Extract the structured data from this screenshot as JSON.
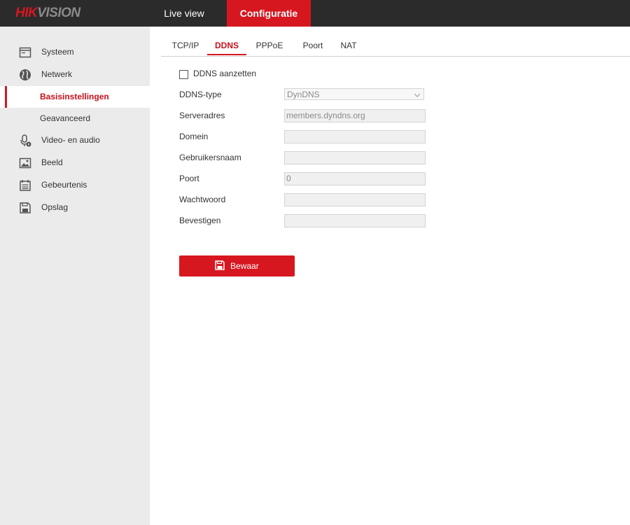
{
  "brand": {
    "logo_hik": "HIK",
    "logo_vision": "VISION"
  },
  "topnav": {
    "live_view": "Live view",
    "configuratie": "Configuratie"
  },
  "sidebar": {
    "items": [
      {
        "label": "Systeem",
        "icon": "system-icon"
      },
      {
        "label": "Netwerk",
        "icon": "globe-icon"
      },
      {
        "label": "Basisinstellingen",
        "active": true
      },
      {
        "label": "Geavanceerd"
      },
      {
        "label": "Video- en audio",
        "icon": "microphone-icon"
      },
      {
        "label": "Beeld",
        "icon": "image-icon"
      },
      {
        "label": "Gebeurtenis",
        "icon": "calendar-icon"
      },
      {
        "label": "Opslag",
        "icon": "storage-icon"
      }
    ]
  },
  "tabs": [
    {
      "label": "TCP/IP"
    },
    {
      "label": "DDNS",
      "active": true
    },
    {
      "label": "PPPoE"
    },
    {
      "label": "Poort"
    },
    {
      "label": "NAT"
    }
  ],
  "form": {
    "enable_label": "DDNS aanzetten",
    "enable_checked": false,
    "ddns_type_label": "DDNS-type",
    "ddns_type_value": "DynDNS",
    "server_label": "Serveradres",
    "server_value": "members.dyndns.org",
    "domain_label": "Domein",
    "domain_value": "",
    "username_label": "Gebruikersnaam",
    "username_value": "",
    "port_label": "Poort",
    "port_value": "0",
    "password_label": "Wachtwoord",
    "password_value": "",
    "confirm_label": "Bevestigen",
    "confirm_value": ""
  },
  "actions": {
    "save_label": "Bewaar"
  },
  "colors": {
    "accent": "#d7171f",
    "topbar": "#2b2b2b",
    "sidebar": "#ebebeb"
  }
}
